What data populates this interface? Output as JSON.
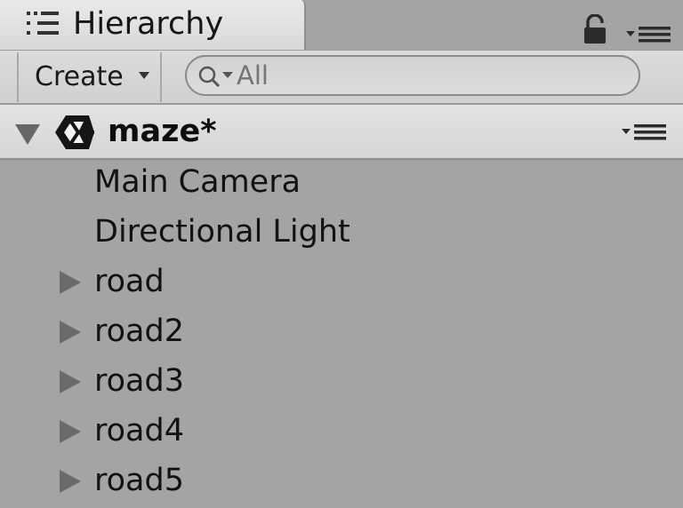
{
  "panel": {
    "title": "Hierarchy",
    "icon": "hierarchy-list-icon",
    "lock_icon": "lock-icon",
    "menu_icon": "panel-menu-icon"
  },
  "toolbar": {
    "create_label": "Create",
    "search_placeholder": "All",
    "search_value": ""
  },
  "scene": {
    "name": "maze*",
    "icon": "unity-logo-icon"
  },
  "tree": {
    "items": [
      {
        "label": "Main Camera",
        "has_children": false
      },
      {
        "label": "Directional Light",
        "has_children": false
      },
      {
        "label": "road",
        "has_children": true
      },
      {
        "label": "road2",
        "has_children": true
      },
      {
        "label": "road3",
        "has_children": true
      },
      {
        "label": "road4",
        "has_children": true
      },
      {
        "label": "road5",
        "has_children": true
      }
    ]
  },
  "colors": {
    "panel_background": "#a4a4a4",
    "tab_background": "#e2e2e2",
    "header_background": "#dcdcdc",
    "text": "#121212"
  }
}
